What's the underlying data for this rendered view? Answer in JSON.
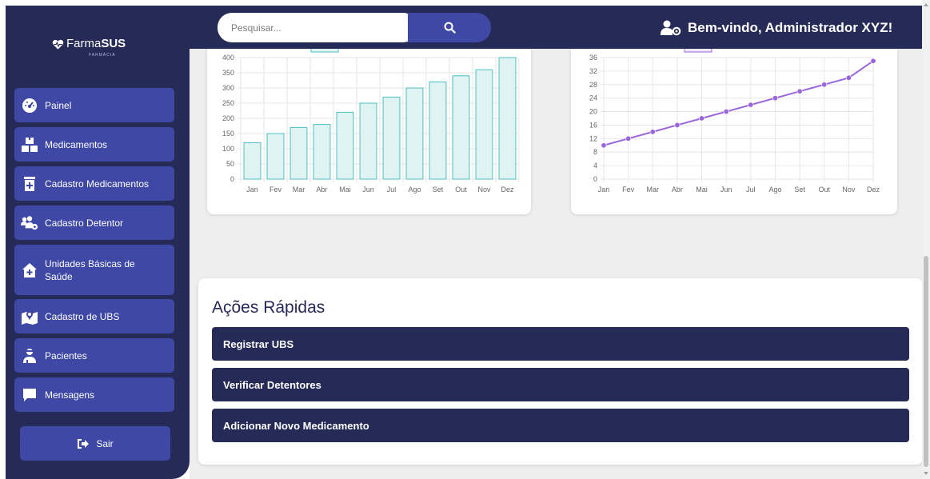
{
  "logo": {
    "brand_light": "Farma",
    "brand_bold": "SUS",
    "subtitle": "FARMÁCIA"
  },
  "sidebar": {
    "items": [
      {
        "label": "Painel",
        "icon": "gauge-icon"
      },
      {
        "label": "Medicamentos",
        "icon": "boxes-icon"
      },
      {
        "label": "Cadastro Medicamentos",
        "icon": "cabinet-plus-icon"
      },
      {
        "label": "Cadastro Detentor",
        "icon": "users-gear-icon"
      },
      {
        "label": "Unidades Básicas de Saúde",
        "icon": "house-medical-icon"
      },
      {
        "label": "Cadastro de UBS",
        "icon": "map-location-icon"
      },
      {
        "label": "Pacientes",
        "icon": "user-injured-icon"
      },
      {
        "label": "Mensagens",
        "icon": "message-icon"
      }
    ],
    "logout_label": "Sair"
  },
  "header": {
    "search_placeholder": "Pesquisar...",
    "welcome": "Bem-vindo, Administrador XYZ!"
  },
  "chart_data": [
    {
      "type": "bar",
      "categories": [
        "Jan",
        "Fev",
        "Mar",
        "Abr",
        "Mai",
        "Jun",
        "Jul",
        "Ago",
        "Set",
        "Out",
        "Nov",
        "Dez"
      ],
      "values": [
        120,
        150,
        170,
        180,
        220,
        250,
        270,
        300,
        320,
        340,
        360,
        400
      ],
      "ylim": [
        0,
        400
      ],
      "yticks": [
        0,
        50,
        100,
        150,
        200,
        250,
        300,
        350,
        400
      ],
      "grid": true,
      "color": "#4bc0c0",
      "fill": "#dff3f3"
    },
    {
      "type": "line",
      "categories": [
        "Jan",
        "Fev",
        "Mar",
        "Abr",
        "Mai",
        "Jun",
        "Jul",
        "Ago",
        "Set",
        "Out",
        "Nov",
        "Dez"
      ],
      "values": [
        10,
        12,
        14,
        16,
        18,
        20,
        22,
        24,
        26,
        28,
        30,
        35
      ],
      "ylim": [
        0,
        36
      ],
      "yticks": [
        0,
        4,
        8,
        12,
        16,
        20,
        24,
        28,
        32,
        36
      ],
      "grid": true,
      "color": "#9966dd"
    }
  ],
  "quick_actions": {
    "title": "Ações Rápidas",
    "buttons": [
      "Registrar UBS",
      "Verificar Detentores",
      "Adicionar Novo Medicamento"
    ]
  }
}
